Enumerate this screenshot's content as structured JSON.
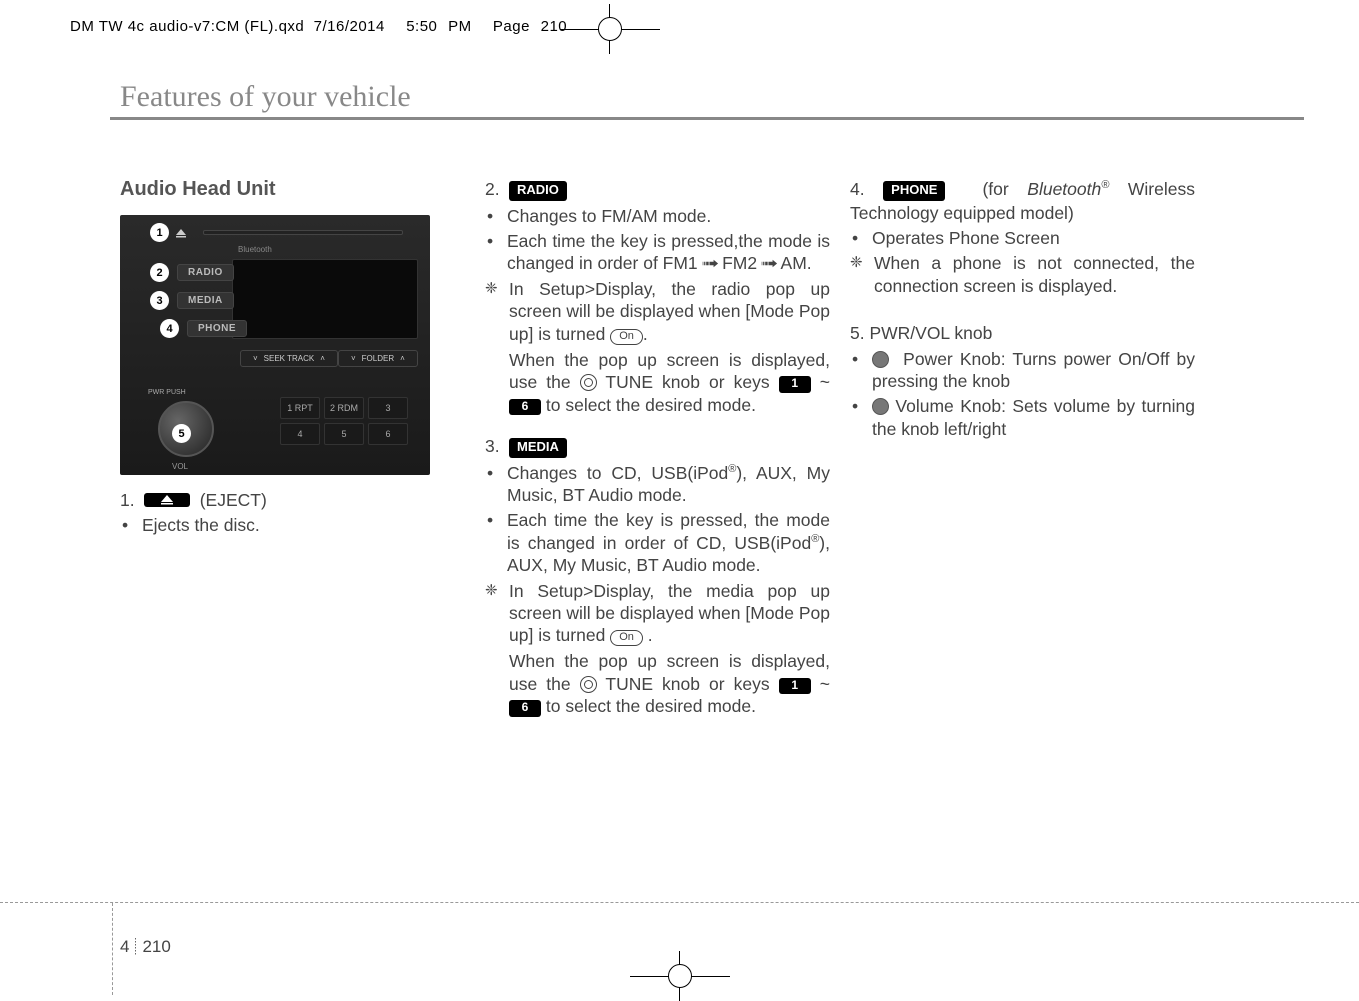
{
  "meta": {
    "filename": "DM TW 4c audio-v7:CM (FL).qxd",
    "date": "7/16/2014",
    "time": "5:50 PM",
    "page_print": "Page 210"
  },
  "section_title": "Features of your vehicle",
  "page_chapter": "4",
  "page_number": "210",
  "heading": "Audio Head Unit",
  "figure": {
    "callouts": [
      "1",
      "2",
      "3",
      "4",
      "5"
    ],
    "buttons": {
      "radio": "RADIO",
      "media": "MEDIA",
      "phone": "PHONE"
    },
    "seek": "SEEK TRACK",
    "folder": "FOLDER",
    "presets": [
      "1 RPT",
      "2 RDM",
      "3",
      "4",
      "5",
      "6"
    ],
    "pwr": "PWR PUSH",
    "vol": "VOL",
    "bt": "Bluetooth"
  },
  "badges": {
    "radio": "RADIO",
    "media": "MEDIA",
    "phone": "PHONE",
    "k1": "1",
    "k6": "6",
    "on": "On"
  },
  "item1": {
    "num": "1.",
    "label_after": "(EJECT)",
    "b1": "Ejects the disc."
  },
  "item2": {
    "num": "2.",
    "b1": "Changes to FM/AM mode.",
    "b2a": "Each time the key is pressed,the mode is changed in order of FM1",
    "b2b": "FM2",
    "b2c": "AM.",
    "n1a": "In Setup>Display, the radio pop up screen will be displayed when [Mode Pop up] is turned",
    "n1b": ".",
    "n2a": "When the pop up screen is displayed, use the",
    "n2b": "TUNE knob or keys",
    "n2c": "~",
    "n2d": "to select the desired mode."
  },
  "item3": {
    "num": "3.",
    "b1a": "Changes to CD, USB(iPod",
    "b1b": "), AUX, My Music, BT Audio mode.",
    "b2a": "Each time the key is pressed, the mode is changed in order of CD, USB(iPod",
    "b2b": "), AUX, My Music, BT Audio mode.",
    "n1a": "In Setup>Display, the media pop up screen will be displayed when [Mode Pop up] is turned",
    "n1b": ".",
    "n2a": "When the pop up screen is displayed, use the",
    "n2b": "TUNE knob or keys",
    "n2c": "~",
    "n2d": "to select the desired mode."
  },
  "item4": {
    "num": "4.",
    "after1": "(for",
    "bt": "Bluetooth",
    "after2": "Wireless Technology equipped model)",
    "b1": "Operates Phone Screen",
    "n1": "When a phone is not connected, the connection screen is displayed."
  },
  "item5": {
    "num": "5. PWR/VOL knob",
    "b1": "Power Knob: Turns power On/Off by pressing the knob",
    "b2": "Volume Knob: Sets volume by turning the knob left/right"
  }
}
